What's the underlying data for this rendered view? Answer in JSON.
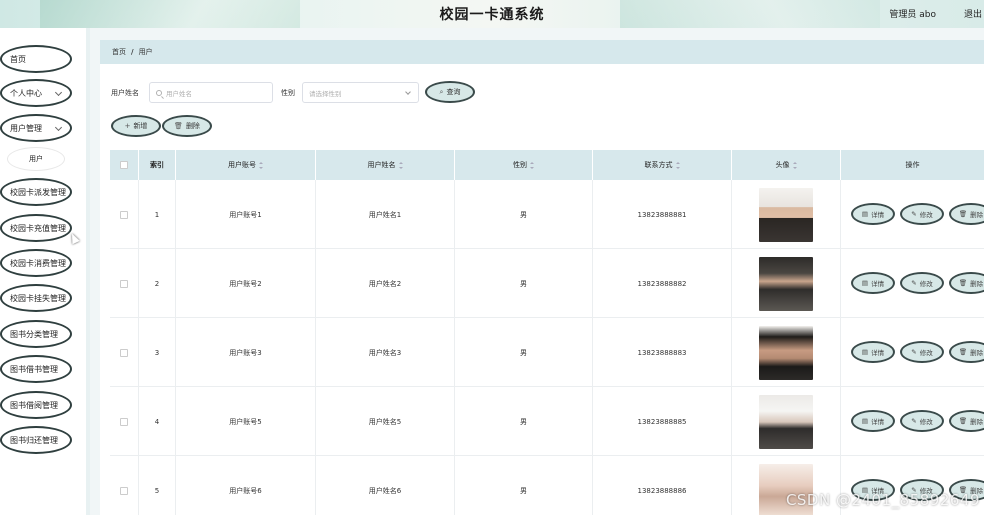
{
  "header": {
    "title": "校园一卡通系统",
    "user": "管理员 abo",
    "logout": "退出"
  },
  "sidebar": {
    "items": [
      {
        "label": "首页",
        "expandable": false
      },
      {
        "label": "个人中心",
        "expandable": true
      },
      {
        "label": "用户管理",
        "expandable": true
      },
      {
        "label": "用户",
        "sub": true
      },
      {
        "label": "校园卡派发管理",
        "expandable": false
      },
      {
        "label": "校园卡充值管理",
        "expandable": false
      },
      {
        "label": "校园卡消费管理",
        "expandable": false
      },
      {
        "label": "校园卡挂失管理",
        "expandable": false
      },
      {
        "label": "图书分类管理",
        "expandable": false
      },
      {
        "label": "图书借书管理",
        "expandable": false
      },
      {
        "label": "图书借阅管理",
        "expandable": false
      },
      {
        "label": "图书归还管理",
        "expandable": false
      }
    ]
  },
  "breadcrumb": {
    "home": "首页",
    "separator": "/",
    "current": "用户"
  },
  "search": {
    "name_label": "用户姓名",
    "name_placeholder": "用户姓名",
    "gender_label": "性别",
    "gender_placeholder": "请选择性别",
    "query_button": "查询"
  },
  "actions": {
    "add": "新增",
    "delete": "删除"
  },
  "table": {
    "columns": [
      "索引",
      "用户账号",
      "用户姓名",
      "性别",
      "联系方式",
      "头像",
      "操作"
    ],
    "rows": [
      {
        "index": "1",
        "account": "用户账号1",
        "name": "用户姓名1",
        "gender": "男",
        "phone": "13823888881",
        "avatar": "avatar-1"
      },
      {
        "index": "2",
        "account": "用户账号2",
        "name": "用户姓名2",
        "gender": "男",
        "phone": "13823888882",
        "avatar": "avatar-2"
      },
      {
        "index": "3",
        "account": "用户账号3",
        "name": "用户姓名3",
        "gender": "男",
        "phone": "13823888883",
        "avatar": "avatar-3"
      },
      {
        "index": "4",
        "account": "用户账号5",
        "name": "用户姓名5",
        "gender": "男",
        "phone": "13823888885",
        "avatar": "avatar-4"
      },
      {
        "index": "5",
        "account": "用户账号6",
        "name": "用户姓名6",
        "gender": "男",
        "phone": "13823888886",
        "avatar": "avatar-5"
      }
    ],
    "row_actions": {
      "detail": "详情",
      "edit": "修改",
      "delete": "删除"
    }
  },
  "watermark": "CSDN @2401_85892649",
  "colors": {
    "accent": "#d7e8e7",
    "header_row": "#d7e8ec",
    "border": "#3a4a4a"
  }
}
